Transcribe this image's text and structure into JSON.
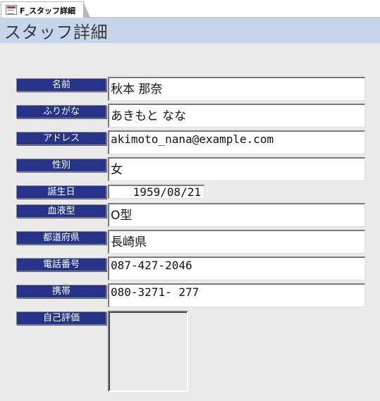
{
  "tab": {
    "label": "F_スタッフ詳細",
    "icon": "form-icon"
  },
  "header": {
    "title": "スタッフ詳細"
  },
  "fields": [
    {
      "label": "名前",
      "value": "秋本 那奈"
    },
    {
      "label": "ふりがな",
      "value": "あきもと なな"
    },
    {
      "label": "アドレス",
      "value": "akimoto_nana@example.com"
    },
    {
      "label": "性別",
      "value": "女"
    },
    {
      "label": "誕生日",
      "value": "1959/08/21"
    },
    {
      "label": "血液型",
      "value": "O型"
    },
    {
      "label": "都道府県",
      "value": "長崎県"
    },
    {
      "label": "電話番号",
      "value": "087-427-2046"
    },
    {
      "label": "携帯",
      "value": "080-3271- 277"
    },
    {
      "label": "自己評価",
      "value": ""
    }
  ],
  "colors": {
    "label_bg": "#253488",
    "header_bg": "#c5d5ea",
    "body_bg": "#eaeaea"
  }
}
